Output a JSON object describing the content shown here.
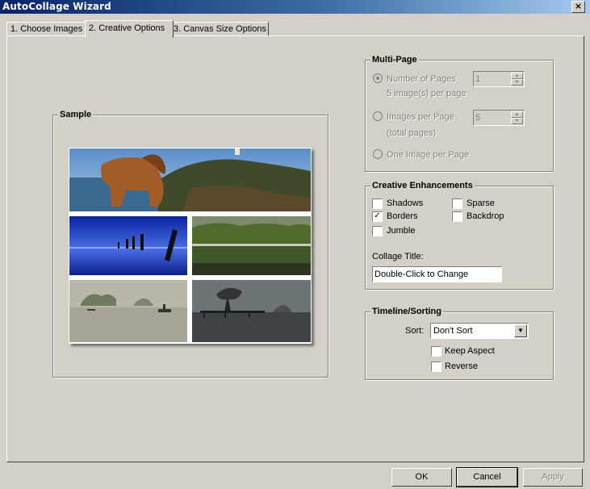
{
  "window": {
    "title": "AutoCollage Wizard",
    "close_glyph": "×"
  },
  "tabs": [
    {
      "label": "1. Choose Images"
    },
    {
      "label": "2. Creative Options"
    },
    {
      "label": "3. Canvas Size Options"
    }
  ],
  "sample": {
    "title": "Sample"
  },
  "multipage": {
    "title": "Multi-Page",
    "num_pages_label": "Number of Pages",
    "num_pages_sub": "5 image(s) per page",
    "num_pages_value": "1",
    "images_per_page_label": "Images per Page",
    "images_per_page_sub": "(total pages)",
    "images_per_page_value": "5",
    "one_image_label": "One Image per Page"
  },
  "creative": {
    "title": "Creative Enhancements",
    "shadows": "Shadows",
    "sparse": "Sparse",
    "borders": "Borders",
    "backdrop": "Backdrop",
    "jumble": "Jumble",
    "check_mark": "✓",
    "collage_title_label": "Collage Title:",
    "collage_title_value": "Double-Click to Change"
  },
  "timeline": {
    "title": "Timeline/Sorting",
    "sort_label": "Sort:",
    "sort_value": "Don't Sort",
    "keep_aspect": "Keep Aspect",
    "reverse": "Reverse"
  },
  "buttons": {
    "ok": "OK",
    "cancel": "Cancel",
    "apply": "Apply"
  },
  "colors": {
    "face": "#d4d0c8",
    "title_start": "#0a246a",
    "title_end": "#a6caf0"
  },
  "icons": {
    "close": "close-icon",
    "dropdown": "dropdown-arrow-icon"
  }
}
